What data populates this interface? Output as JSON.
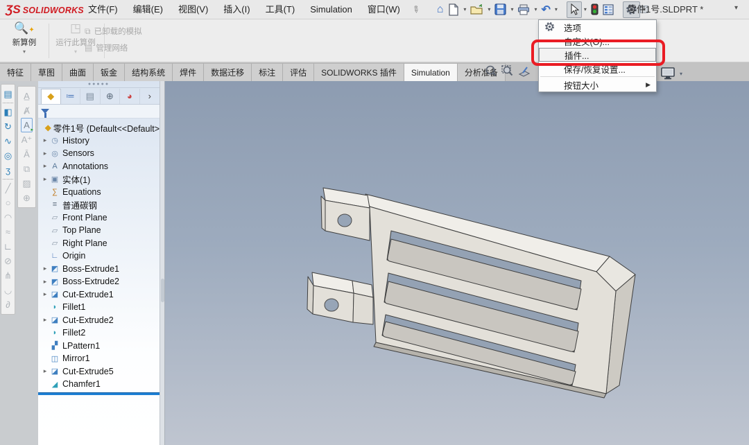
{
  "titlebar": {
    "logo_prefix": "ƷS",
    "logo_text": "SOLIDWORKS",
    "menus": [
      "文件(F)",
      "编辑(E)",
      "视图(V)",
      "插入(I)",
      "工具(T)",
      "Simulation",
      "窗口(W)"
    ],
    "doc_title": "零件1号.SLDPRT *",
    "quick_tools": [
      "home",
      "new-document",
      "open",
      "save",
      "print",
      "undo",
      "select-cursor",
      "rebuild-traffic-light",
      "display-settings-list",
      "options-gear"
    ]
  },
  "ribbon": {
    "study_new": "新算例",
    "study_run": "运行此算例",
    "sim_offloaded": "已卸载的模拟",
    "manage_network": "管理网络"
  },
  "command_tabs": {
    "tabs": [
      "特征",
      "草图",
      "曲面",
      "钣金",
      "结构系统",
      "焊件",
      "数据迁移",
      "标注",
      "评估",
      "SOLIDWORKS 插件",
      "Simulation",
      "分析准备"
    ],
    "active": "Simulation"
  },
  "settings_menu": {
    "items": [
      {
        "label": "选项",
        "icon": "gear-icon"
      },
      {
        "label": "自定义(O)...",
        "icon": null
      },
      {
        "label": "插件...",
        "icon": null,
        "highlighted": true
      },
      {
        "label": "保存/恢复设置...",
        "icon": null
      },
      {
        "label": "按钮大小",
        "icon": null,
        "submenu": true
      }
    ],
    "annotation_color": "#ea1c24"
  },
  "feature_tree": {
    "panel_tabs": [
      "featuremanager",
      "propertymanager",
      "configurationmanager",
      "dimxpertmanager",
      "displaymanager",
      "expand-chevron"
    ],
    "root": "零件1号 (Default<<Default>",
    "items": [
      {
        "label": "History",
        "icon": "history-folder",
        "expandable": true
      },
      {
        "label": "Sensors",
        "icon": "sensors-folder",
        "expandable": true
      },
      {
        "label": "Annotations",
        "icon": "annotations-folder",
        "expandable": true
      },
      {
        "label": "实体(1)",
        "icon": "solid-bodies-folder",
        "expandable": true
      },
      {
        "label": "Equations",
        "icon": "equations",
        "expandable": false
      },
      {
        "label": "普通碳钢",
        "icon": "material",
        "expandable": false
      },
      {
        "label": "Front Plane",
        "icon": "plane",
        "expandable": false
      },
      {
        "label": "Top Plane",
        "icon": "plane",
        "expandable": false
      },
      {
        "label": "Right Plane",
        "icon": "plane",
        "expandable": false
      },
      {
        "label": "Origin",
        "icon": "origin",
        "expandable": false
      },
      {
        "label": "Boss-Extrude1",
        "icon": "boss-extrude",
        "expandable": true
      },
      {
        "label": "Boss-Extrude2",
        "icon": "boss-extrude",
        "expandable": true
      },
      {
        "label": "Cut-Extrude1",
        "icon": "cut-extrude",
        "expandable": true
      },
      {
        "label": "Fillet1",
        "icon": "fillet",
        "expandable": false
      },
      {
        "label": "Cut-Extrude2",
        "icon": "cut-extrude",
        "expandable": true
      },
      {
        "label": "Fillet2",
        "icon": "fillet",
        "expandable": false
      },
      {
        "label": "LPattern1",
        "icon": "linear-pattern",
        "expandable": false
      },
      {
        "label": "Mirror1",
        "icon": "mirror",
        "expandable": false
      },
      {
        "label": "Cut-Extrude5",
        "icon": "cut-extrude",
        "expandable": true
      },
      {
        "label": "Chamfer1",
        "icon": "chamfer",
        "expandable": false
      }
    ]
  },
  "left_rail": {
    "primary_icons": [
      "view-cube",
      "extruded-boss",
      "revolved-boss",
      "swept-boss",
      "lofted-boss",
      "boundary-boss",
      "fillet-tool",
      "chamfer-tool",
      "draft-tool",
      "wrap-tool",
      "rib-tool",
      "mirror-tool",
      "trim-tool",
      "dome-tool",
      "freeform-tool"
    ],
    "secondary_icons": [
      "smart-dimension",
      "model-items",
      "annotation-view",
      "datum-target",
      "balloon",
      "copy-annotation",
      "weld-symbol",
      "annotation-settings"
    ]
  },
  "viewport": {
    "hud_icons": [
      "zoom-to-fit",
      "zoom-to-area",
      "section-view",
      "display-style-monitor"
    ],
    "gradient_top": "#8d9cb1",
    "gradient_bottom": "#bfc5d0",
    "model_part": "零件1号 bracket with two tabs and three slots"
  }
}
